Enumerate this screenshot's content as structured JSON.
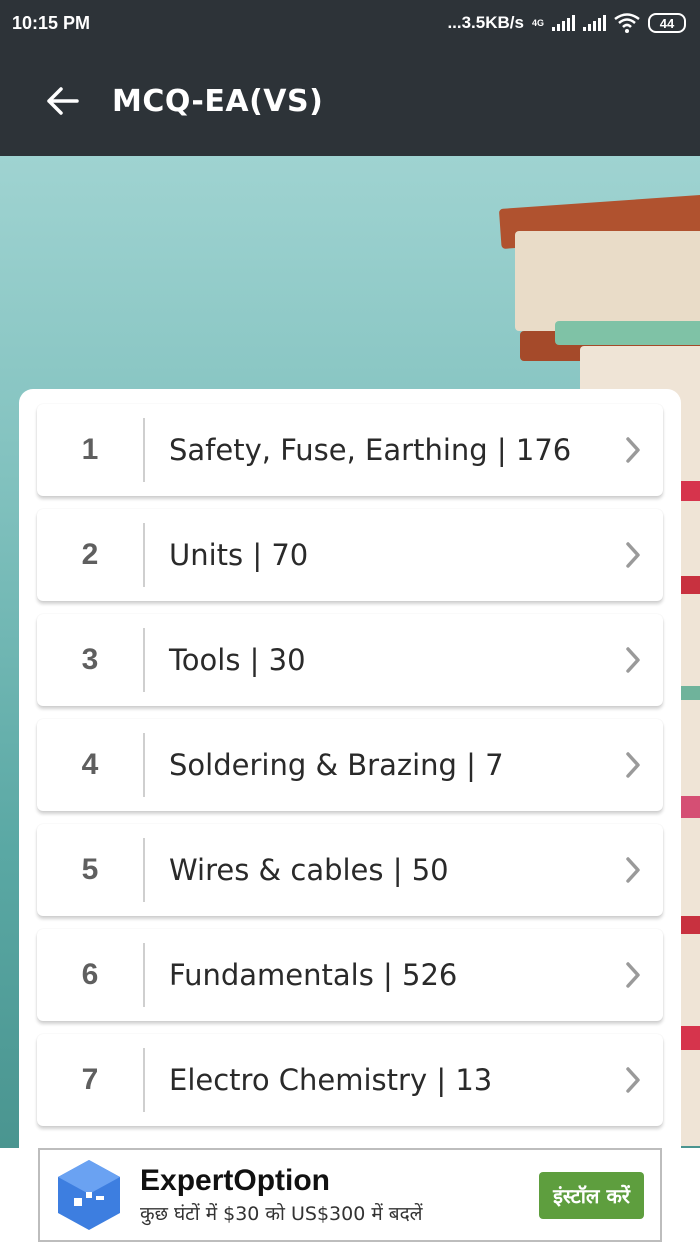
{
  "status_bar": {
    "time": "10:15 PM",
    "net_speed": "...3.5KB/s",
    "network_type": "4G",
    "battery": "44"
  },
  "app_bar": {
    "back_icon": "arrow-left-icon",
    "title": "MCQ-EA(VS)"
  },
  "topics": [
    {
      "number": "1",
      "label": "Safety, Fuse, Earthing | 176"
    },
    {
      "number": "2",
      "label": "Units | 70"
    },
    {
      "number": "3",
      "label": "Tools | 30"
    },
    {
      "number": "4",
      "label": "Soldering & Brazing | 7"
    },
    {
      "number": "5",
      "label": "Wires & cables | 50"
    },
    {
      "number": "6",
      "label": "Fundamentals | 526"
    },
    {
      "number": "7",
      "label": "Electro Chemistry | 13"
    }
  ],
  "ad": {
    "title": "ExpertOption",
    "subtitle": "कुछ घंटों में $30 को US$300 में बदलें",
    "button": "इंस्टॉल करें",
    "button_color": "#5e9e3e"
  },
  "colors": {
    "bar": "#2d3338",
    "background": "#7fc0bd"
  }
}
